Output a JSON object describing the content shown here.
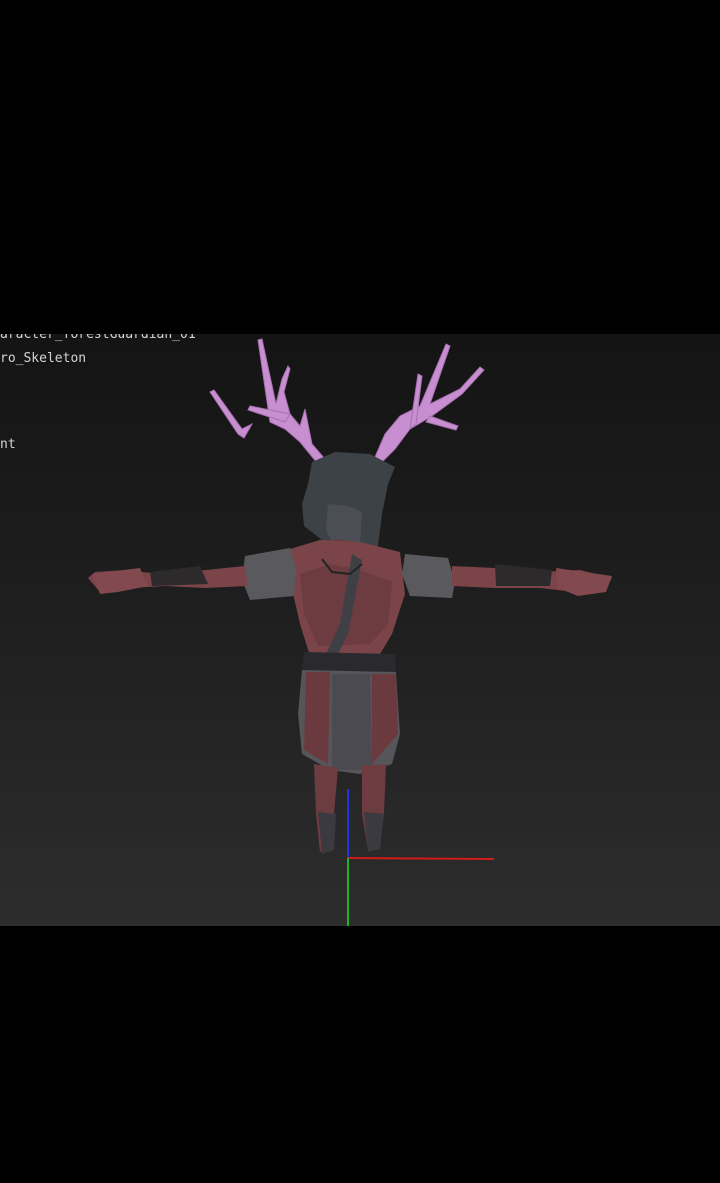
{
  "viewport": {
    "background_top": "#141414",
    "background_bottom": "#2d2d2d"
  },
  "outliner": {
    "lines": [
      "aracter_forestGuardian_01",
      "ro_Skeleton",
      "nt"
    ]
  },
  "axes": {
    "x_color": "#d21c1c",
    "y_color": "#1fb31f",
    "z_color": "#2233dd"
  },
  "character": {
    "antler_color": "#c88fd0",
    "skin_color": "#7a4448",
    "cloth_color": "#5a5a5e",
    "hair_color": "#3d4246"
  }
}
